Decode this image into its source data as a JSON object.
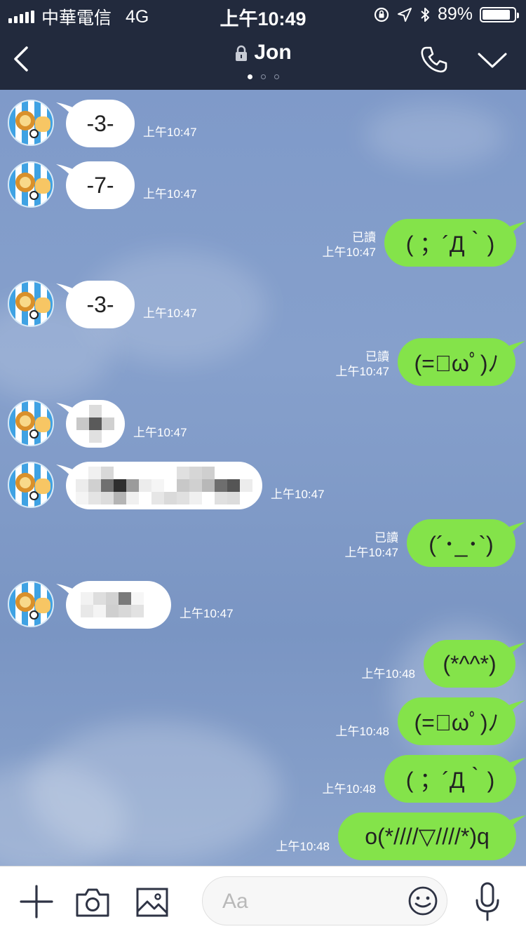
{
  "status_bar": {
    "carrier": "中華電信",
    "network": "4G",
    "time": "上午10:49",
    "battery_text": "89%",
    "battery_level": 0.89
  },
  "header": {
    "title": "Jon",
    "page_dots": 3,
    "active_dot": 0
  },
  "messages": [
    {
      "side": "in",
      "text": "-3-",
      "time": "上午10:47"
    },
    {
      "side": "in",
      "text": "-7-",
      "time": "上午10:47"
    },
    {
      "side": "out",
      "text": "( ；´Д｀)",
      "time": "上午10:47",
      "read": "已讀"
    },
    {
      "side": "in",
      "text": "-3-",
      "time": "上午10:47"
    },
    {
      "side": "out",
      "text": "(=ﾟωﾟ)ﾉ",
      "time": "上午10:47",
      "read": "已讀"
    },
    {
      "side": "in",
      "text": "",
      "time": "上午10:47",
      "pixelated": true
    },
    {
      "side": "in",
      "text": "",
      "time": "上午10:47",
      "pixelated": true
    },
    {
      "side": "out",
      "text": "(´･_･`)",
      "time": "上午10:47",
      "read": "已讀"
    },
    {
      "side": "in",
      "text": "",
      "time": "上午10:47",
      "pixelated": true
    },
    {
      "side": "out",
      "text": "(*^^*)",
      "time": "上午10:48"
    },
    {
      "side": "out",
      "text": "(=ﾟωﾟ)ﾉ",
      "time": "上午10:48"
    },
    {
      "side": "out",
      "text": "( ；´Д｀)",
      "time": "上午10:48"
    },
    {
      "side": "out",
      "text": "o(*////▽////*)q",
      "time": "上午10:48"
    }
  ],
  "input": {
    "placeholder": "Aa"
  },
  "icons": [
    "back-chevron-icon",
    "lock-icon",
    "phone-icon",
    "chevron-down-icon",
    "plus-icon",
    "camera-icon",
    "image-icon",
    "smile-icon",
    "microphone-icon"
  ],
  "colors": {
    "header_bg": "#222a3d",
    "chat_bg": "#7f9ac9",
    "outgoing_bubble": "#84e34a",
    "incoming_bubble": "#ffffff"
  }
}
